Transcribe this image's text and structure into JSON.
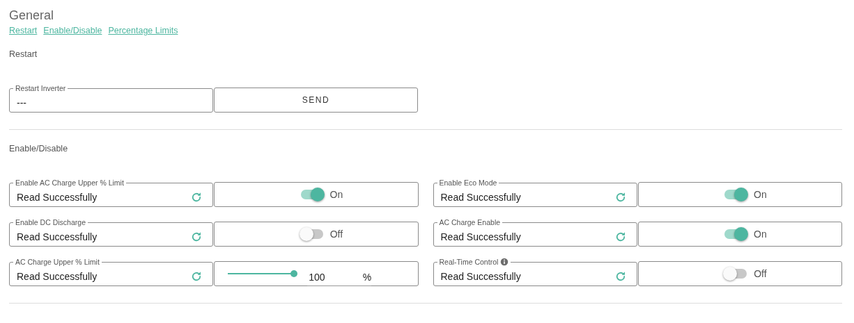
{
  "title": "General",
  "links": [
    "Restart",
    "Enable/Disable",
    "Percentage Limits"
  ],
  "restart": {
    "heading": "Restart",
    "field": {
      "label": "Restart Inverter",
      "value": "---"
    },
    "button": "SEND"
  },
  "enable": {
    "heading": "Enable/Disable",
    "settings": [
      {
        "label": "Enable AC Charge Upper % Limit",
        "value": "Read Successfully",
        "control": {
          "kind": "toggle",
          "on": true,
          "text": "On"
        }
      },
      {
        "label": "Enable Eco Mode",
        "value": "Read Successfully",
        "control": {
          "kind": "toggle",
          "on": true,
          "text": "On"
        }
      },
      {
        "label": "Enable DC Discharge",
        "value": "Read Successfully",
        "control": {
          "kind": "toggle",
          "on": false,
          "text": "Off"
        }
      },
      {
        "label": "AC Charge Enable",
        "value": "Read Successfully",
        "control": {
          "kind": "toggle",
          "on": true,
          "text": "On"
        }
      },
      {
        "label": "AC Charge Upper % Limit",
        "value": "Read Successfully",
        "control": {
          "kind": "slider",
          "level": 1,
          "value": "100",
          "unit": "%"
        }
      },
      {
        "label": "Real-Time Control",
        "info": true,
        "value": "Read Successfully",
        "control": {
          "kind": "toggle",
          "on": false,
          "text": "Off"
        }
      }
    ]
  }
}
